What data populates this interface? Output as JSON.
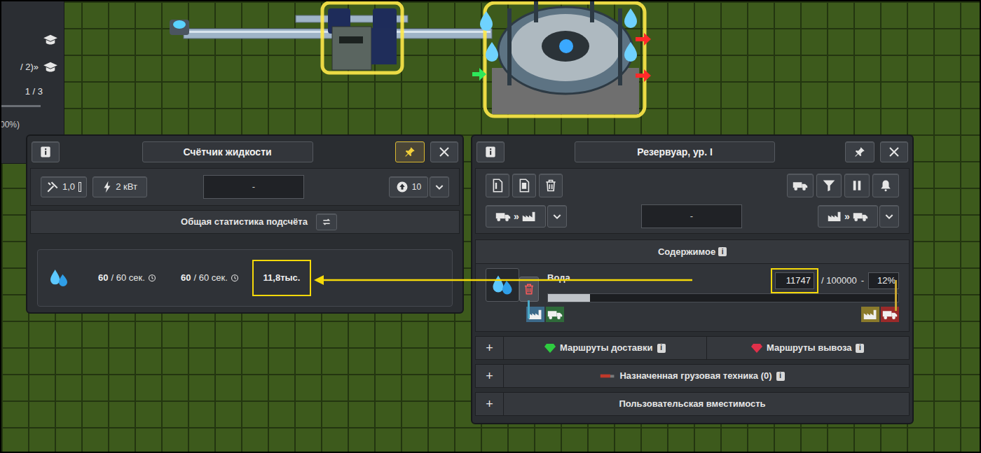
{
  "side_panel": {
    "items": [
      {
        "text": "/ 2)»"
      },
      {
        "text": "1 / 3"
      },
      {
        "text": "00%)"
      }
    ]
  },
  "counter_window": {
    "title": "Счётчик жидкости",
    "pinned": true,
    "maintenance": "1,0",
    "power": "2 кВт",
    "name_field": "-",
    "priority": "10",
    "stats_header": "Общая статистика подсчёта",
    "stats": {
      "input": "60",
      "input_period": "/ 60 сек.",
      "output": "60",
      "output_period": "/ 60 сек.",
      "total": "11,8тыс.",
      "highlighted": true
    }
  },
  "tank_window": {
    "title": "Резервуар, ур. I",
    "pinned": false,
    "name_field": "-",
    "import_arrow": "»",
    "export_arrow": "»",
    "contents_header": "Содержимое",
    "contents_info": "i",
    "product": {
      "name": "Вода",
      "amount": "11747",
      "capacity": "/ 100000",
      "separator": "-",
      "percent": "12%",
      "level": 0.12,
      "highlighted": true
    },
    "sections": [
      {
        "kind": "split",
        "expand": "+",
        "parts": [
          {
            "label": "Маршруты доставки",
            "info": "i",
            "color": "#2ecc40"
          },
          {
            "label": "Маршруты вывоза",
            "info": "i",
            "color": "#e0304a"
          }
        ]
      },
      {
        "kind": "single",
        "expand": "+",
        "label": "Назначенная грузовая техника (0)",
        "info": "i"
      },
      {
        "kind": "single",
        "expand": "+",
        "label": "Пользовательская вместимость",
        "info": ""
      }
    ]
  },
  "annotation": {
    "arrow_from": "tank_window.product.amount",
    "arrow_to": "counter_window.stats.total"
  }
}
